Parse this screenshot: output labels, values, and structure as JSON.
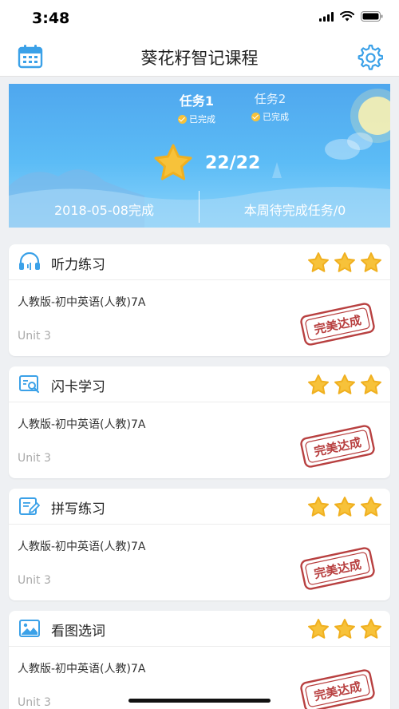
{
  "status_bar": {
    "time": "3:48"
  },
  "nav": {
    "title": "葵花籽智记课程",
    "left_icon": "calendar-icon",
    "right_icon": "gear-icon"
  },
  "banner": {
    "tasks": [
      {
        "label": "任务1",
        "status": "已完成",
        "active": true
      },
      {
        "label": "任务2",
        "status": "已完成",
        "active": false
      }
    ],
    "score": "22/22",
    "date_text": "2018-05-08完成",
    "weekly_text": "本周待完成任务/0"
  },
  "cards": [
    {
      "title": "听力练习",
      "icon": "headphones-icon",
      "book": "人教版-初中英语(人教)7A",
      "unit": "Unit 3",
      "stars": 3,
      "stamp": "完美达成"
    },
    {
      "title": "闪卡学习",
      "icon": "flashcard-icon",
      "book": "人教版-初中英语(人教)7A",
      "unit": "Unit 3",
      "stars": 3,
      "stamp": "完美达成"
    },
    {
      "title": "拼写练习",
      "icon": "spelling-icon",
      "book": "人教版-初中英语(人教)7A",
      "unit": "Unit 3",
      "stars": 3,
      "stamp": "完美达成"
    },
    {
      "title": "看图选词",
      "icon": "picture-icon",
      "book": "人教版-初中英语(人教)7A",
      "unit": "Unit 3",
      "stars": 3,
      "stamp": "完美达成"
    }
  ],
  "colors": {
    "primary": "#3ba1e8",
    "star": "#f7c23a",
    "stamp": "#b84040"
  }
}
